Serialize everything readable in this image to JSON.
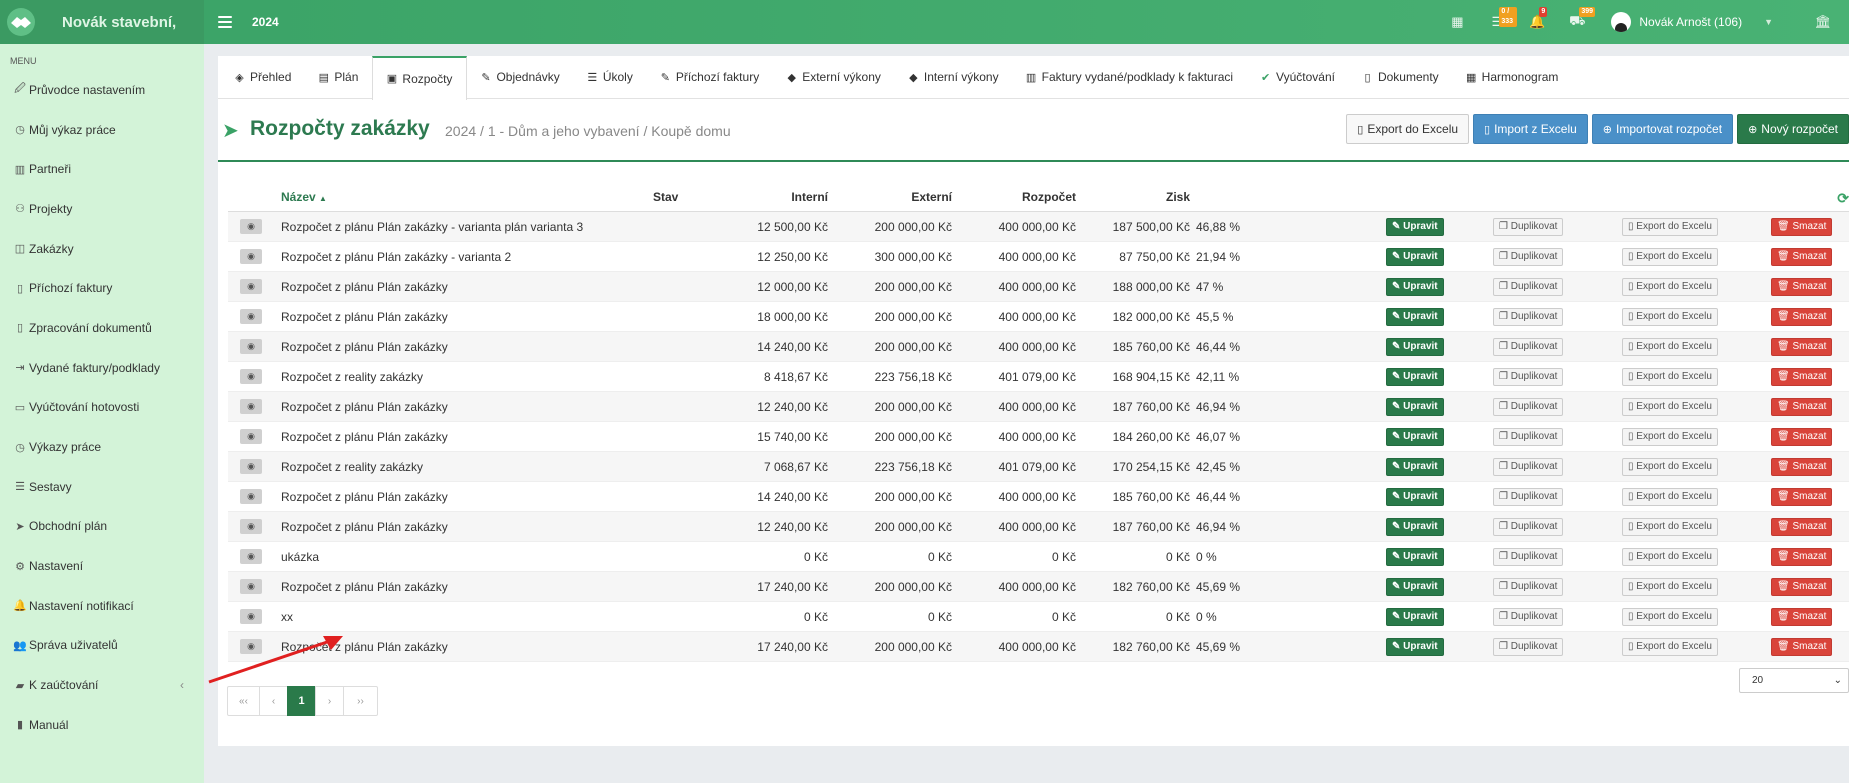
{
  "app": {
    "brand": "Novák stavební,",
    "year": "2024"
  },
  "topbar": {
    "badges": {
      "tasks": "0 / 333",
      "notifications": "9",
      "trucks": "399"
    },
    "user": "Novák Arnošt (106)"
  },
  "sidebar": {
    "menu_label": "MENU",
    "items": [
      {
        "label": "Průvodce nastavením",
        "icon": "wrench-icon",
        "glyph": "🖉"
      },
      {
        "label": "Můj výkaz práce",
        "icon": "clock-icon",
        "glyph": "◷"
      },
      {
        "label": "Partneři",
        "icon": "building-icon",
        "glyph": "▥"
      },
      {
        "label": "Projekty",
        "icon": "cubes-icon",
        "glyph": "⚇"
      },
      {
        "label": "Zakázky",
        "icon": "cube-icon",
        "glyph": "◫"
      },
      {
        "label": "Příchozí faktury",
        "icon": "file-icon",
        "glyph": "▯"
      },
      {
        "label": "Zpracování dokumentů",
        "icon": "file-text-icon",
        "glyph": "▯"
      },
      {
        "label": "Vydané faktury/podklady",
        "icon": "export-icon",
        "glyph": "⇥"
      },
      {
        "label": "Vyúčtování hotovosti",
        "icon": "money-icon",
        "glyph": "▭"
      },
      {
        "label": "Výkazy práce",
        "icon": "clock-icon",
        "glyph": "◷"
      },
      {
        "label": "Sestavy",
        "icon": "list-icon",
        "glyph": "☰"
      },
      {
        "label": "Obchodní plán",
        "icon": "paper-plane-icon",
        "glyph": "➤"
      },
      {
        "label": "Nastavení",
        "icon": "cogs-icon",
        "glyph": "⚙"
      },
      {
        "label": "Nastavení notifikací",
        "icon": "bell-icon",
        "glyph": "🔔"
      },
      {
        "label": "Správa uživatelů",
        "icon": "users-icon",
        "glyph": "👥"
      },
      {
        "label": "K zaúčtování",
        "icon": "folder-icon",
        "glyph": "▰"
      },
      {
        "label": "Manuál",
        "icon": "book-icon",
        "glyph": "▮"
      }
    ]
  },
  "tabs": [
    {
      "label": "Přehled",
      "glyph": "◈"
    },
    {
      "label": "Plán",
      "glyph": "▤"
    },
    {
      "label": "Rozpočty",
      "glyph": "▣"
    },
    {
      "label": "Objednávky",
      "glyph": "✎"
    },
    {
      "label": "Úkoly",
      "glyph": "☰"
    },
    {
      "label": "Příchozí faktury",
      "glyph": "✎"
    },
    {
      "label": "Externí výkony",
      "glyph": "◆"
    },
    {
      "label": "Interní výkony",
      "glyph": "◆"
    },
    {
      "label": "Faktury vydané/podklady k fakturaci",
      "glyph": "▥"
    },
    {
      "label": "Vyúčtování",
      "glyph": "✔"
    },
    {
      "label": "Dokumenty",
      "glyph": "▯"
    },
    {
      "label": "Harmonogram",
      "glyph": "▦"
    }
  ],
  "page": {
    "title": "Rozpočty zakázky",
    "subtitle": "2024 / 1 - Dům a jeho vybavení / Koupě domu"
  },
  "actions": {
    "export": "Export do Excelu",
    "import": "Import z Excelu",
    "import_budget": "Importovat rozpočet",
    "new_budget": "Nový rozpočet"
  },
  "table": {
    "headers": {
      "name": "Název",
      "stav": "Stav",
      "internal": "Interní",
      "external": "Externí",
      "budget": "Rozpočet",
      "profit": "Zisk"
    },
    "row_actions": {
      "edit": "Upravit",
      "duplicate": "Duplikovat",
      "export": "Export do Excelu",
      "delete": "Smazat"
    },
    "rows": [
      {
        "name": "Rozpočet z plánu Plán zakázky - varianta plán varianta 3",
        "internal": "12 500,00 Kč",
        "external": "200 000,00 Kč",
        "budget": "400 000,00 Kč",
        "profit": "187 500,00 Kč",
        "pct": "46,88 %"
      },
      {
        "name": "Rozpočet z plánu Plán zakázky - varianta 2",
        "internal": "12 250,00 Kč",
        "external": "300 000,00 Kč",
        "budget": "400 000,00 Kč",
        "profit": "87 750,00 Kč",
        "pct": "21,94 %"
      },
      {
        "name": "Rozpočet z plánu Plán zakázky",
        "internal": "12 000,00 Kč",
        "external": "200 000,00 Kč",
        "budget": "400 000,00 Kč",
        "profit": "188 000,00 Kč",
        "pct": "47 %"
      },
      {
        "name": "Rozpočet z plánu Plán zakázky",
        "internal": "18 000,00 Kč",
        "external": "200 000,00 Kč",
        "budget": "400 000,00 Kč",
        "profit": "182 000,00 Kč",
        "pct": "45,5 %"
      },
      {
        "name": "Rozpočet z plánu Plán zakázky",
        "internal": "14 240,00 Kč",
        "external": "200 000,00 Kč",
        "budget": "400 000,00 Kč",
        "profit": "185 760,00 Kč",
        "pct": "46,44 %"
      },
      {
        "name": "Rozpočet z reality zakázky",
        "internal": "8 418,67 Kč",
        "external": "223 756,18 Kč",
        "budget": "401 079,00 Kč",
        "profit": "168 904,15 Kč",
        "pct": "42,11 %"
      },
      {
        "name": "Rozpočet z plánu Plán zakázky",
        "internal": "12 240,00 Kč",
        "external": "200 000,00 Kč",
        "budget": "400 000,00 Kč",
        "profit": "187 760,00 Kč",
        "pct": "46,94 %"
      },
      {
        "name": "Rozpočet z plánu Plán zakázky",
        "internal": "15 740,00 Kč",
        "external": "200 000,00 Kč",
        "budget": "400 000,00 Kč",
        "profit": "184 260,00 Kč",
        "pct": "46,07 %"
      },
      {
        "name": "Rozpočet z reality zakázky",
        "internal": "7 068,67 Kč",
        "external": "223 756,18 Kč",
        "budget": "401 079,00 Kč",
        "profit": "170 254,15 Kč",
        "pct": "42,45 %"
      },
      {
        "name": "Rozpočet z plánu Plán zakázky",
        "internal": "14 240,00 Kč",
        "external": "200 000,00 Kč",
        "budget": "400 000,00 Kč",
        "profit": "185 760,00 Kč",
        "pct": "46,44 %"
      },
      {
        "name": "Rozpočet z plánu Plán zakázky",
        "internal": "12 240,00 Kč",
        "external": "200 000,00 Kč",
        "budget": "400 000,00 Kč",
        "profit": "187 760,00 Kč",
        "pct": "46,94 %"
      },
      {
        "name": "ukázka",
        "internal": "0 Kč",
        "external": "0 Kč",
        "budget": "0 Kč",
        "profit": "0 Kč",
        "pct": "0 %"
      },
      {
        "name": "Rozpočet z plánu Plán zakázky",
        "internal": "17 240,00 Kč",
        "external": "200 000,00 Kč",
        "budget": "400 000,00 Kč",
        "profit": "182 760,00 Kč",
        "pct": "45,69 %"
      },
      {
        "name": "xx",
        "internal": "0 Kč",
        "external": "0 Kč",
        "budget": "0 Kč",
        "profit": "0 Kč",
        "pct": "0 %"
      },
      {
        "name": "Rozpočet z plánu Plán zakázky",
        "internal": "17 240,00 Kč",
        "external": "200 000,00 Kč",
        "budget": "400 000,00 Kč",
        "profit": "182 760,00 Kč",
        "pct": "45,69 %"
      }
    ]
  },
  "pagination": {
    "first": "«‹",
    "prev": "‹",
    "current": "1",
    "next": "›",
    "last": "››",
    "per_page": "20"
  },
  "colors": {
    "accent": "#3aa266",
    "danger": "#d9443a",
    "primary": "#4a90c8",
    "annotation_arrow": "#e02020"
  }
}
